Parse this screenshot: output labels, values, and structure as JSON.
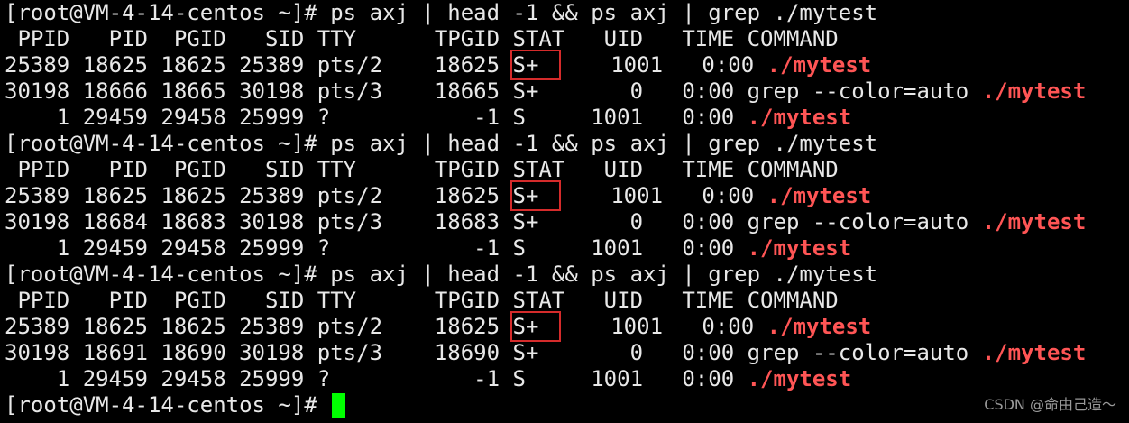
{
  "terminal": {
    "background": "#000000",
    "foreground": "#e8e8e8",
    "highlight_color": "#ff5555",
    "annotation_box_color": "#d52b2b",
    "cursor_color": "#00ff00",
    "lines": [
      [
        {
          "text": "[root@VM-4-14-centos ~]# ps axj | head -1 && ps axj | grep ./mytest"
        }
      ],
      [
        {
          "text": " PPID   PID  PGID   SID TTY      TPGID STAT   UID   TIME COMMAND"
        }
      ],
      [
        {
          "text": "25389 18625 18625 25389 pts/2    18625 "
        },
        {
          "text": "S+",
          "box": true
        },
        {
          "text": "    1001   0:00 "
        },
        {
          "text": "./mytest",
          "red": true
        }
      ],
      [
        {
          "text": "30198 18666 18665 30198 pts/3    18665 S+       0   0:00 grep --color=auto "
        },
        {
          "text": "./mytest",
          "red": true
        }
      ],
      [
        {
          "text": "    1 29459 29458 25999 ?           -1 S     1001   0:00 "
        },
        {
          "text": "./mytest",
          "red": true
        }
      ],
      [
        {
          "text": "[root@VM-4-14-centos ~]# ps axj | head -1 && ps axj | grep ./mytest"
        }
      ],
      [
        {
          "text": " PPID   PID  PGID   SID TTY      TPGID STAT   UID   TIME COMMAND"
        }
      ],
      [
        {
          "text": "25389 18625 18625 25389 pts/2    18625 "
        },
        {
          "text": "S+",
          "box": true
        },
        {
          "text": "    1001   0:00 "
        },
        {
          "text": "./mytest",
          "red": true
        }
      ],
      [
        {
          "text": "30198 18684 18683 30198 pts/3    18683 S+       0   0:00 grep --color=auto "
        },
        {
          "text": "./mytest",
          "red": true
        }
      ],
      [
        {
          "text": "    1 29459 29458 25999 ?           -1 S     1001   0:00 "
        },
        {
          "text": "./mytest",
          "red": true
        }
      ],
      [
        {
          "text": "[root@VM-4-14-centos ~]# ps axj | head -1 && ps axj | grep ./mytest"
        }
      ],
      [
        {
          "text": " PPID   PID  PGID   SID TTY      TPGID STAT   UID   TIME COMMAND"
        }
      ],
      [
        {
          "text": "25389 18625 18625 25389 pts/2    18625 "
        },
        {
          "text": "S+",
          "box": true
        },
        {
          "text": "    1001   0:00 "
        },
        {
          "text": "./mytest",
          "red": true
        }
      ],
      [
        {
          "text": "30198 18691 18690 30198 pts/3    18690 S+       0   0:00 grep --color=auto "
        },
        {
          "text": "./mytest",
          "red": true
        }
      ],
      [
        {
          "text": "    1 29459 29458 25999 ?           -1 S     1001   0:00 "
        },
        {
          "text": "./mytest",
          "red": true
        }
      ],
      [
        {
          "text": "[root@VM-4-14-centos ~]# "
        },
        {
          "cursor": true
        }
      ]
    ]
  },
  "watermark": {
    "text": "CSDN @命由己造～"
  }
}
